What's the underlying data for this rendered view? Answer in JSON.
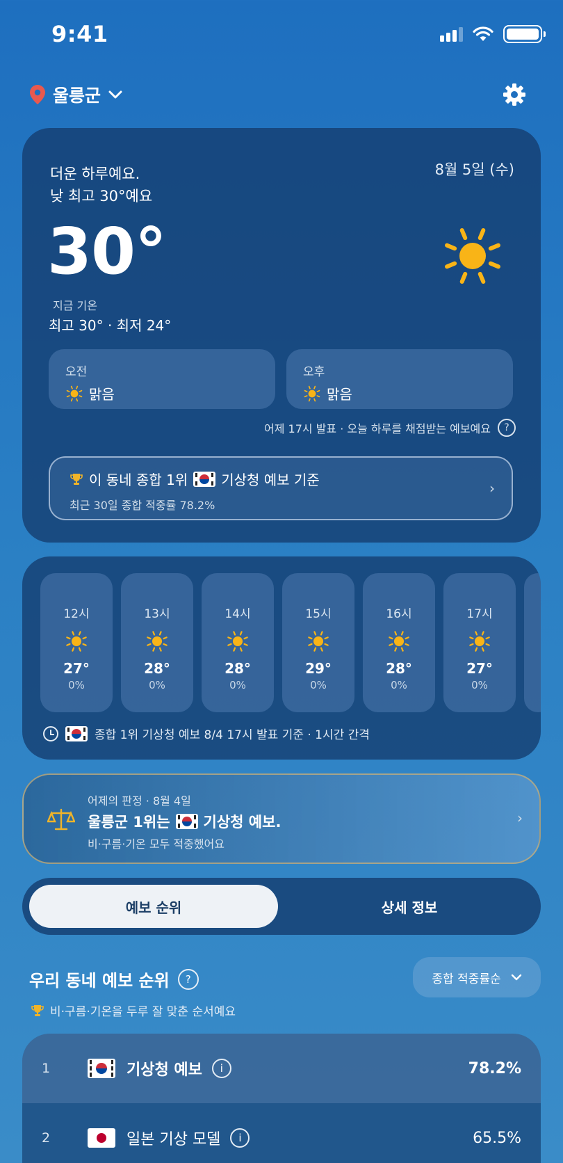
{
  "status": {
    "time": "9:41"
  },
  "header": {
    "location": "울릉군"
  },
  "hero": {
    "summary_line1": "더운 하루예요.",
    "summary_line2": "낮 최고 30°예요",
    "date": "8월 5일 (수)",
    "temp": "30°",
    "now_label": "지금 기온",
    "hilo": "최고 30° · 최저 24°",
    "am_label": "오전",
    "am_cond": "맑음",
    "pm_label": "오후",
    "pm_cond": "맑음",
    "note": "어제 17시 발표 · 오늘 하루를 채점받는 예보예요",
    "rank_title_pre": "이 동네 종합 1위",
    "rank_title_post": "기상청 예보 기준",
    "rank_sub": "최근 30일 종합 적중률 78.2%"
  },
  "hourly": {
    "items": [
      {
        "time": "12시",
        "temp": "27°",
        "rain": "0%",
        "icon": "sun-icon"
      },
      {
        "time": "13시",
        "temp": "28°",
        "rain": "0%",
        "icon": "sun-icon"
      },
      {
        "time": "14시",
        "temp": "28°",
        "rain": "0%",
        "icon": "sun-icon"
      },
      {
        "time": "15시",
        "temp": "29°",
        "rain": "0%",
        "icon": "sun-icon"
      },
      {
        "time": "16시",
        "temp": "28°",
        "rain": "0%",
        "icon": "sun-icon"
      },
      {
        "time": "17시",
        "temp": "27°",
        "rain": "0%",
        "icon": "sun-icon"
      }
    ],
    "footer": "종합 1위 기상청 예보 8/4 17시 발표 기준 · 1시간 간격"
  },
  "verdict": {
    "small": "어제의 판정 · 8월 4일",
    "main_pre": "울릉군 1위는",
    "main_post": "기상청 예보.",
    "sub": "비·구름·기온 모두 적중했어요"
  },
  "tabs": {
    "active": "예보 순위",
    "inactive": "상세 정보"
  },
  "ranking": {
    "title": "우리 동네 예보 순위",
    "sort": "종합 적중률순",
    "subtitle": "비·구름·기온을 두루 잘 맞춘 순서예요",
    "rows": [
      {
        "rank": "1",
        "name": "기상청 예보",
        "pct": "78.2%",
        "flag": "kr"
      },
      {
        "rank": "2",
        "name": "일본 기상 모델",
        "pct": "65.5%",
        "flag": "jp"
      }
    ]
  },
  "colors": {
    "sun": "#f9b417",
    "trophy": "#f0b429",
    "pin": "#e8594f"
  }
}
